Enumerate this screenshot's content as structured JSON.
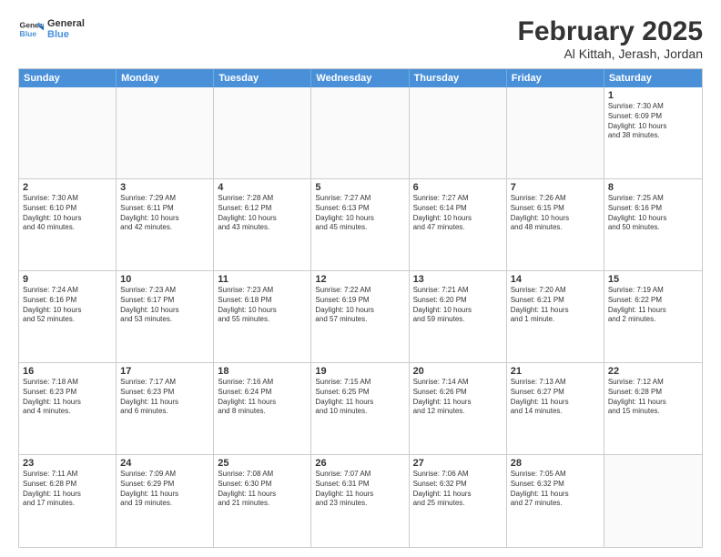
{
  "header": {
    "logo_general": "General",
    "logo_blue": "Blue",
    "month": "February 2025",
    "location": "Al Kittah, Jerash, Jordan"
  },
  "weekdays": [
    "Sunday",
    "Monday",
    "Tuesday",
    "Wednesday",
    "Thursday",
    "Friday",
    "Saturday"
  ],
  "weeks": [
    [
      {
        "day": "",
        "info": ""
      },
      {
        "day": "",
        "info": ""
      },
      {
        "day": "",
        "info": ""
      },
      {
        "day": "",
        "info": ""
      },
      {
        "day": "",
        "info": ""
      },
      {
        "day": "",
        "info": ""
      },
      {
        "day": "1",
        "info": "Sunrise: 7:30 AM\nSunset: 6:09 PM\nDaylight: 10 hours\nand 38 minutes."
      }
    ],
    [
      {
        "day": "2",
        "info": "Sunrise: 7:30 AM\nSunset: 6:10 PM\nDaylight: 10 hours\nand 40 minutes."
      },
      {
        "day": "3",
        "info": "Sunrise: 7:29 AM\nSunset: 6:11 PM\nDaylight: 10 hours\nand 42 minutes."
      },
      {
        "day": "4",
        "info": "Sunrise: 7:28 AM\nSunset: 6:12 PM\nDaylight: 10 hours\nand 43 minutes."
      },
      {
        "day": "5",
        "info": "Sunrise: 7:27 AM\nSunset: 6:13 PM\nDaylight: 10 hours\nand 45 minutes."
      },
      {
        "day": "6",
        "info": "Sunrise: 7:27 AM\nSunset: 6:14 PM\nDaylight: 10 hours\nand 47 minutes."
      },
      {
        "day": "7",
        "info": "Sunrise: 7:26 AM\nSunset: 6:15 PM\nDaylight: 10 hours\nand 48 minutes."
      },
      {
        "day": "8",
        "info": "Sunrise: 7:25 AM\nSunset: 6:16 PM\nDaylight: 10 hours\nand 50 minutes."
      }
    ],
    [
      {
        "day": "9",
        "info": "Sunrise: 7:24 AM\nSunset: 6:16 PM\nDaylight: 10 hours\nand 52 minutes."
      },
      {
        "day": "10",
        "info": "Sunrise: 7:23 AM\nSunset: 6:17 PM\nDaylight: 10 hours\nand 53 minutes."
      },
      {
        "day": "11",
        "info": "Sunrise: 7:23 AM\nSunset: 6:18 PM\nDaylight: 10 hours\nand 55 minutes."
      },
      {
        "day": "12",
        "info": "Sunrise: 7:22 AM\nSunset: 6:19 PM\nDaylight: 10 hours\nand 57 minutes."
      },
      {
        "day": "13",
        "info": "Sunrise: 7:21 AM\nSunset: 6:20 PM\nDaylight: 10 hours\nand 59 minutes."
      },
      {
        "day": "14",
        "info": "Sunrise: 7:20 AM\nSunset: 6:21 PM\nDaylight: 11 hours\nand 1 minute."
      },
      {
        "day": "15",
        "info": "Sunrise: 7:19 AM\nSunset: 6:22 PM\nDaylight: 11 hours\nand 2 minutes."
      }
    ],
    [
      {
        "day": "16",
        "info": "Sunrise: 7:18 AM\nSunset: 6:23 PM\nDaylight: 11 hours\nand 4 minutes."
      },
      {
        "day": "17",
        "info": "Sunrise: 7:17 AM\nSunset: 6:23 PM\nDaylight: 11 hours\nand 6 minutes."
      },
      {
        "day": "18",
        "info": "Sunrise: 7:16 AM\nSunset: 6:24 PM\nDaylight: 11 hours\nand 8 minutes."
      },
      {
        "day": "19",
        "info": "Sunrise: 7:15 AM\nSunset: 6:25 PM\nDaylight: 11 hours\nand 10 minutes."
      },
      {
        "day": "20",
        "info": "Sunrise: 7:14 AM\nSunset: 6:26 PM\nDaylight: 11 hours\nand 12 minutes."
      },
      {
        "day": "21",
        "info": "Sunrise: 7:13 AM\nSunset: 6:27 PM\nDaylight: 11 hours\nand 14 minutes."
      },
      {
        "day": "22",
        "info": "Sunrise: 7:12 AM\nSunset: 6:28 PM\nDaylight: 11 hours\nand 15 minutes."
      }
    ],
    [
      {
        "day": "23",
        "info": "Sunrise: 7:11 AM\nSunset: 6:28 PM\nDaylight: 11 hours\nand 17 minutes."
      },
      {
        "day": "24",
        "info": "Sunrise: 7:09 AM\nSunset: 6:29 PM\nDaylight: 11 hours\nand 19 minutes."
      },
      {
        "day": "25",
        "info": "Sunrise: 7:08 AM\nSunset: 6:30 PM\nDaylight: 11 hours\nand 21 minutes."
      },
      {
        "day": "26",
        "info": "Sunrise: 7:07 AM\nSunset: 6:31 PM\nDaylight: 11 hours\nand 23 minutes."
      },
      {
        "day": "27",
        "info": "Sunrise: 7:06 AM\nSunset: 6:32 PM\nDaylight: 11 hours\nand 25 minutes."
      },
      {
        "day": "28",
        "info": "Sunrise: 7:05 AM\nSunset: 6:32 PM\nDaylight: 11 hours\nand 27 minutes."
      },
      {
        "day": "",
        "info": ""
      }
    ]
  ]
}
